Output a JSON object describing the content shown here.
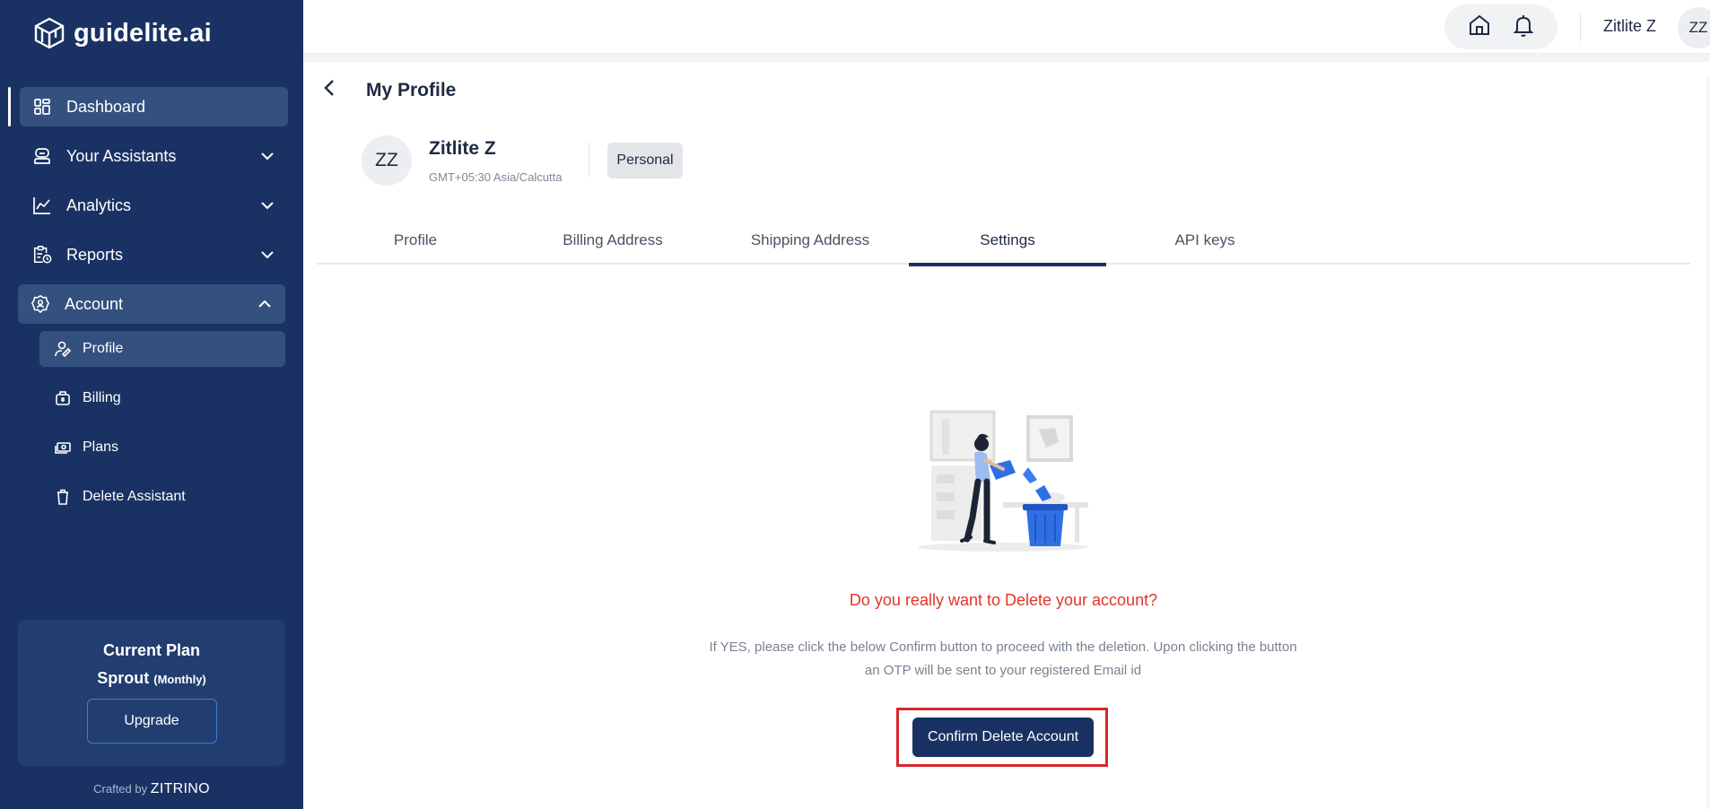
{
  "app": {
    "logo_text": "guidelite.ai"
  },
  "sidebar": {
    "items": [
      {
        "label": "Dashboard",
        "icon": "dashboard-icon"
      },
      {
        "label": "Your Assistants",
        "icon": "assistant-icon"
      },
      {
        "label": "Analytics",
        "icon": "analytics-icon"
      },
      {
        "label": "Reports",
        "icon": "reports-icon"
      },
      {
        "label": "Account",
        "icon": "account-gear-icon"
      }
    ],
    "account_sub": [
      {
        "label": "Profile",
        "icon": "user-edit-icon"
      },
      {
        "label": "Billing",
        "icon": "billing-icon"
      },
      {
        "label": "Plans",
        "icon": "money-icon"
      },
      {
        "label": "Delete Assistant",
        "icon": "trash-icon"
      }
    ],
    "plan": {
      "title": "Current Plan",
      "name": "Sprout",
      "period": "(Monthly)",
      "upgrade_label": "Upgrade"
    },
    "crafted": {
      "prefix": "Crafted by",
      "brand": "ZITRINO"
    }
  },
  "header": {
    "user_name": "Zitlite Z",
    "avatar_initials": "ZZ"
  },
  "profile": {
    "page_title": "My Profile",
    "initials": "ZZ",
    "name": "Zitlite Z",
    "timezone": "GMT+05:30 Asia/Calcutta",
    "badge": "Personal"
  },
  "tabs": [
    {
      "label": "Profile",
      "active": false
    },
    {
      "label": "Billing Address",
      "active": false
    },
    {
      "label": "Shipping Address",
      "active": false
    },
    {
      "label": "Settings",
      "active": true
    },
    {
      "label": "API keys",
      "active": false
    }
  ],
  "delete_section": {
    "question": "Do you really want to Delete your account?",
    "description_line1": "If YES, please click the below Confirm button to proceed with the deletion. Upon clicking the button",
    "description_line2": "an OTP will be sent to your registered Email id",
    "confirm_label": "Confirm Delete Account"
  },
  "colors": {
    "sidebar": "#1a3263",
    "active_item": "#34507f",
    "danger": "#e0352b",
    "highlight_box": "#d8262b"
  }
}
